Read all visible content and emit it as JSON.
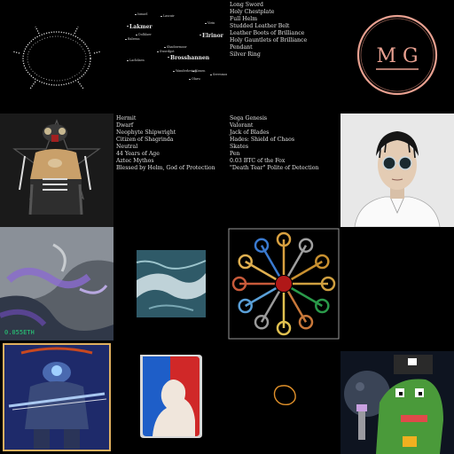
{
  "colors": {
    "background": "#000000",
    "price": "#27d27a",
    "ring_outer": "#e8a090",
    "ring_inner": "#f0c8b0"
  },
  "map": {
    "labels": [
      {
        "text": "Ismael",
        "cls": ""
      },
      {
        "text": "Lascuir",
        "cls": ""
      },
      {
        "text": "Lakmer",
        "cls": "big"
      },
      {
        "text": "Balrenn",
        "cls": ""
      },
      {
        "text": "Dolhlaer",
        "cls": ""
      },
      {
        "text": "Virin",
        "cls": ""
      },
      {
        "text": "Elrinor",
        "cls": "big"
      },
      {
        "text": "Shadowmoor",
        "cls": ""
      },
      {
        "text": "Swordgot",
        "cls": ""
      },
      {
        "text": "Lachdaen",
        "cls": ""
      },
      {
        "text": "Brosshannen",
        "cls": "big"
      },
      {
        "text": "Wanderloving",
        "cls": ""
      },
      {
        "text": "Kiraen",
        "cls": ""
      },
      {
        "text": "Olaru",
        "cls": ""
      },
      {
        "text": "Seresmon",
        "cls": ""
      }
    ]
  },
  "items_list": [
    "Long Sword",
    "Holy Chestplate",
    "Full Helm",
    "Studded Leather Belt",
    "Leather Boots of Brilliance",
    "Holy Gauntlets of Brilliance",
    "Pendant",
    "Silver Ring"
  ],
  "logo": {
    "letters": "M G",
    "color": "#e8a090"
  },
  "character_list": [
    "Hermit",
    "Dwarf",
    "Neophyte Shipwright",
    "Citizen of Shagrinda",
    "Neutral",
    "44 Years of Age",
    "Aztec Mythos",
    "Blessed by Helm, God of Protection"
  ],
  "loot_list": [
    "Sega Genesis",
    "Valorant",
    "Jack of Blades",
    "Hades: Shield of Chaos",
    "Skates",
    "Pen",
    "0.03 BTC of the Fox",
    "\"Death Tear\" Polite of Detection"
  ],
  "price": {
    "text": "0.055ETH"
  }
}
